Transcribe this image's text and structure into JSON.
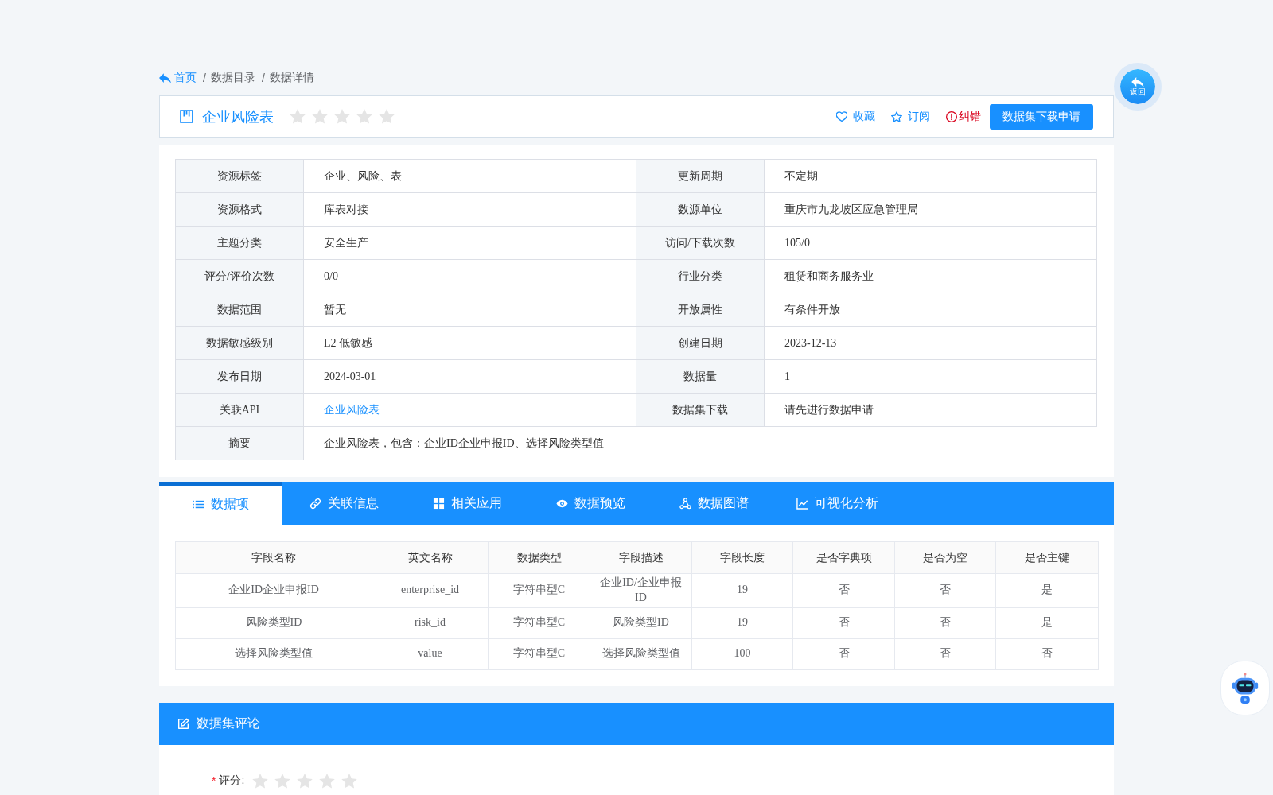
{
  "breadcrumb": {
    "items": [
      {
        "kind": "home",
        "label": "首页"
      },
      {
        "kind": "link",
        "separator": "/",
        "label": "数据目录"
      },
      {
        "kind": "current",
        "separator": "/",
        "label": "数据详情"
      }
    ]
  },
  "title": {
    "text": "企业风险表",
    "stars": 0
  },
  "actions": [
    {
      "kind": "favorite",
      "label": "收藏"
    },
    {
      "kind": "subscribe",
      "label": "订阅"
    },
    {
      "kind": "report",
      "label": "纠错"
    },
    {
      "kind": "primary",
      "label": "数据集下载申请"
    }
  ],
  "back_button": {
    "label": "返回"
  },
  "info": [
    {
      "label": "资源标签",
      "value": "企业、风险、表",
      "kind": "text"
    },
    {
      "label": "更新周期",
      "value": "不定期",
      "kind": "text"
    },
    {
      "label": "资源格式",
      "value": "库表对接",
      "kind": "text"
    },
    {
      "label": "数源单位",
      "value": "重庆市九龙坡区应急管理局",
      "kind": "text"
    },
    {
      "label": "主题分类",
      "value": "安全生产",
      "kind": "text"
    },
    {
      "label": "访问/下载次数",
      "value": "105/0",
      "kind": "text"
    },
    {
      "label": "评分/评价次数",
      "value": "0/0",
      "kind": "text"
    },
    {
      "label": "行业分类",
      "value": "租赁和商务服务业",
      "kind": "text"
    },
    {
      "label": "数据范围",
      "value": "暂无",
      "kind": "text"
    },
    {
      "label": "开放属性",
      "value": "有条件开放",
      "kind": "text"
    },
    {
      "label": "数据敏感级别",
      "value": "L2 低敏感",
      "kind": "text"
    },
    {
      "label": "创建日期",
      "value": "2023-12-13",
      "kind": "text"
    },
    {
      "label": "发布日期",
      "value": "2024-03-01",
      "kind": "text"
    },
    {
      "label": "数据量",
      "value": "1",
      "kind": "text"
    },
    {
      "label": "关联API",
      "value": "企业风险表",
      "kind": "link"
    },
    {
      "label": "数据集下载",
      "value": "请先进行数据申请",
      "kind": "text"
    },
    {
      "label": "摘要",
      "value": "企业风险表，包含：企业ID企业申报ID、选择风险类型值",
      "kind": "text"
    }
  ],
  "tabs": [
    {
      "kind": "list",
      "label": "数据项",
      "selected": true
    },
    {
      "kind": "link",
      "label": "关联信息",
      "selected": false
    },
    {
      "kind": "apps",
      "label": "相关应用",
      "selected": false
    },
    {
      "kind": "preview",
      "label": "数据预览",
      "selected": false
    },
    {
      "kind": "graph",
      "label": "数据图谱",
      "selected": false
    },
    {
      "kind": "chart",
      "label": "可视化分析",
      "selected": false
    }
  ],
  "fields_table": {
    "columns": [
      "字段名称",
      "英文名称",
      "数据类型",
      "字段描述",
      "字段长度",
      "是否字典项",
      "是否为空",
      "是否主键"
    ],
    "rows": [
      [
        "企业ID企业申报ID",
        "enterprise_id",
        "字符串型C",
        "企业ID/企业申报ID",
        "19",
        "否",
        "否",
        "是"
      ],
      [
        "风险类型ID",
        "risk_id",
        "字符串型C",
        "风险类型ID",
        "19",
        "否",
        "否",
        "是"
      ],
      [
        "选择风险类型值",
        "value",
        "字符串型C",
        "选择风险类型值",
        "100",
        "否",
        "否",
        "否"
      ]
    ]
  },
  "comment": {
    "title": "数据集评论",
    "rating": {
      "required_mark": "*",
      "label": "评分:",
      "stars": 0
    }
  }
}
